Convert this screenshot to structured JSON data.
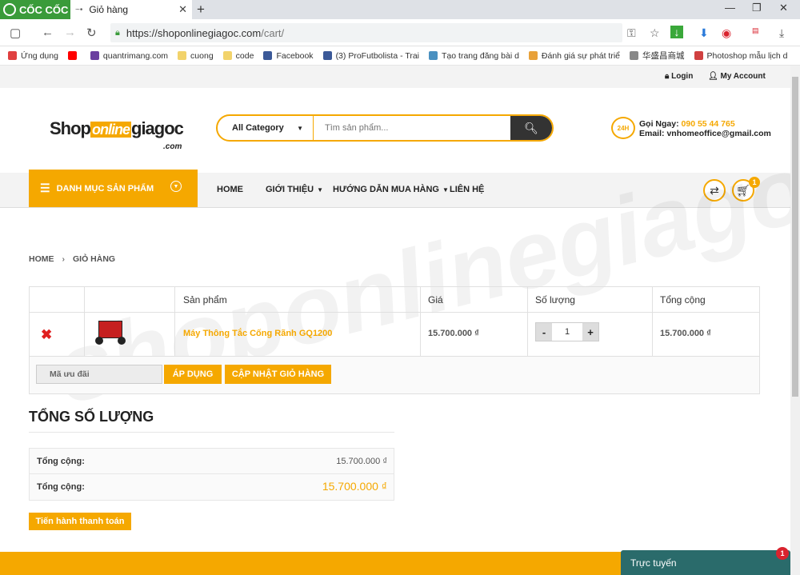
{
  "browser": {
    "brand": "CỐC CỐC",
    "tab_title": "Giỏ hàng",
    "url_host": "https://shoponlinegiagoc.com",
    "url_path": "/cart/",
    "bookmarks": [
      {
        "label": "Ứng dụng",
        "color": "#e04040"
      },
      {
        "label": "",
        "color": "#ff0000"
      },
      {
        "label": "quantrimang.com",
        "color": "#6b3fa0"
      },
      {
        "label": "cuong",
        "color": "#f2d36b"
      },
      {
        "label": "code",
        "color": "#f2d36b"
      },
      {
        "label": "Facebook",
        "color": "#3b5998"
      },
      {
        "label": "(3) ProFutbolista - Trai",
        "color": "#3b5998"
      },
      {
        "label": "Tạo trang đăng bài d",
        "color": "#4a90c0"
      },
      {
        "label": "Đánh giá sự phát triể",
        "color": "#e8a13a"
      },
      {
        "label": "华盛昌商城",
        "color": "#888888"
      },
      {
        "label": "Photoshop mẫu lịch d",
        "color": "#d04040"
      }
    ]
  },
  "topbar": {
    "login": "Login",
    "account": "My Account"
  },
  "header": {
    "logo_shop": "Shop",
    "logo_online": "online",
    "logo_giagoc": "giagoc",
    "logo_com": ".com",
    "search_category": "All Category",
    "search_placeholder": "Tìm sản phẩm...",
    "hotline_label": "Gọi Ngay:",
    "hotline_phone": "090 55 44 765",
    "email_label": "Email:",
    "email": "vnhomeoffice@gmail.com",
    "hotline_icon_text": "24H"
  },
  "nav": {
    "category_label": "DANH MỤC SẢN PHẨM",
    "items": [
      "HOME",
      "GIỚI THIỆU",
      "HƯỚNG DẪN MUA HÀNG",
      "LIÊN HỆ"
    ],
    "cart_count": "1"
  },
  "breadcrumb": {
    "home": "HOME",
    "current": "GIỎ HÀNG"
  },
  "cart": {
    "headers": {
      "product": "Sản phẩm",
      "price": "Giá",
      "quantity": "Số lượng",
      "total": "Tổng cộng"
    },
    "items": [
      {
        "name": "Máy Thông Tắc Cống Rãnh GQ1200",
        "price": "15.700.000 ₫",
        "quantity": "1",
        "total": "15.700.000 ₫"
      }
    ],
    "coupon_placeholder": "Mã ưu đãi",
    "apply_label": "ÁP DỤNG",
    "update_label": "CẬP NHẬT GIỎ HÀNG"
  },
  "summary": {
    "title": "TỔNG SỐ LƯỢNG",
    "subtotal_label": "Tổng cộng:",
    "subtotal_value": "15.700.000 ₫",
    "total_label": "Tổng cộng:",
    "total_value": "15.700.000 ₫",
    "checkout_label": "Tiến hành thanh toán"
  },
  "chat": {
    "label": "Trực tuyến",
    "badge": "1"
  },
  "colors": {
    "accent": "#f5a800",
    "remove": "#e02020",
    "chat": "#2a6b6b"
  }
}
